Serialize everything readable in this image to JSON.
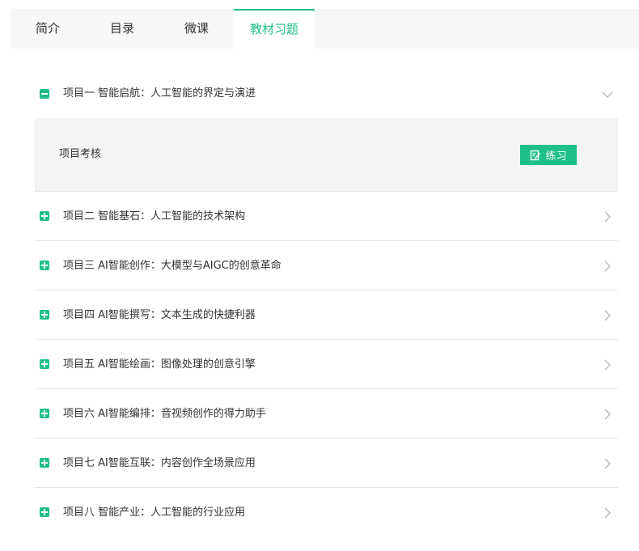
{
  "tabs": [
    {
      "label": "简介",
      "active": false
    },
    {
      "label": "目录",
      "active": false
    },
    {
      "label": "微课",
      "active": false
    },
    {
      "label": "教材习题",
      "active": true
    }
  ],
  "accent_color": "#1fbf8a",
  "projects": [
    {
      "title": "项目一 智能启航：人工智能的界定与演进",
      "expanded": true,
      "toggle_icon": "minus-square-icon",
      "chevron_icon": "chevron-down-icon"
    },
    {
      "title": "项目二 智能基石：人工智能的技术架构",
      "expanded": false,
      "toggle_icon": "plus-square-icon",
      "chevron_icon": "chevron-right-icon"
    },
    {
      "title": "项目三 AI智能创作：大模型与AIGC的创意革命",
      "expanded": false,
      "toggle_icon": "plus-square-icon",
      "chevron_icon": "chevron-right-icon"
    },
    {
      "title": "项目四 AI智能撰写：文本生成的快捷利器",
      "expanded": false,
      "toggle_icon": "plus-square-icon",
      "chevron_icon": "chevron-right-icon"
    },
    {
      "title": "项目五 AI智能绘画：图像处理的创意引擎",
      "expanded": false,
      "toggle_icon": "plus-square-icon",
      "chevron_icon": "chevron-right-icon"
    },
    {
      "title": "项目六 AI智能编排：音视频创作的得力助手",
      "expanded": false,
      "toggle_icon": "plus-square-icon",
      "chevron_icon": "chevron-right-icon"
    },
    {
      "title": "项目七 AI智能互联：内容创作全场景应用",
      "expanded": false,
      "toggle_icon": "plus-square-icon",
      "chevron_icon": "chevron-right-icon"
    },
    {
      "title": "项目八 智能产业：人工智能的行业应用",
      "expanded": false,
      "toggle_icon": "plus-square-icon",
      "chevron_icon": "chevron-right-icon"
    }
  ],
  "subsection": {
    "label": "项目考核",
    "button_label": "练习",
    "button_icon": "edit-icon"
  }
}
